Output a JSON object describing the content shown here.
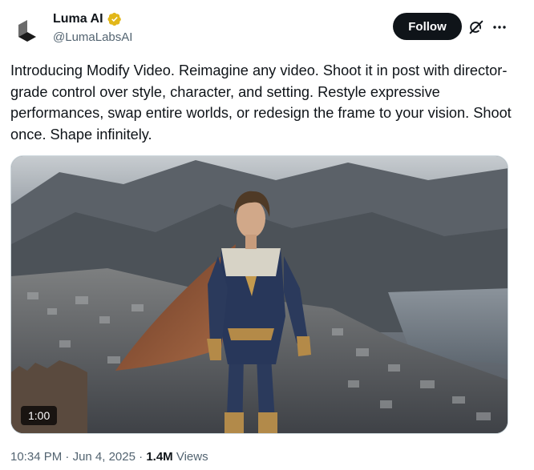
{
  "author": {
    "display_name": "Luma AI",
    "handle": "@LumaLabsAI",
    "verified": true,
    "verified_badge_color": "#e2b719"
  },
  "actions": {
    "follow_label": "Follow",
    "grok_icon": "grok-icon",
    "more_icon": "more-icon"
  },
  "tweet": {
    "text": "Introducing Modify Video. Reimagine any video. Shoot it in post with director-grade control over style, character, and setting. Restyle expressive performances, swap entire worlds, or redesign the frame to your vision. Shoot once. Shape infinitely."
  },
  "media": {
    "type": "video",
    "duration": "1:00"
  },
  "meta": {
    "time": "10:34 PM",
    "date": "Jun 4, 2025",
    "separator": "·",
    "views_count": "1.4M",
    "views_label": "Views"
  },
  "colors": {
    "text_primary": "#0f1419",
    "text_secondary": "#536471",
    "follow_bg": "#0f1419"
  }
}
